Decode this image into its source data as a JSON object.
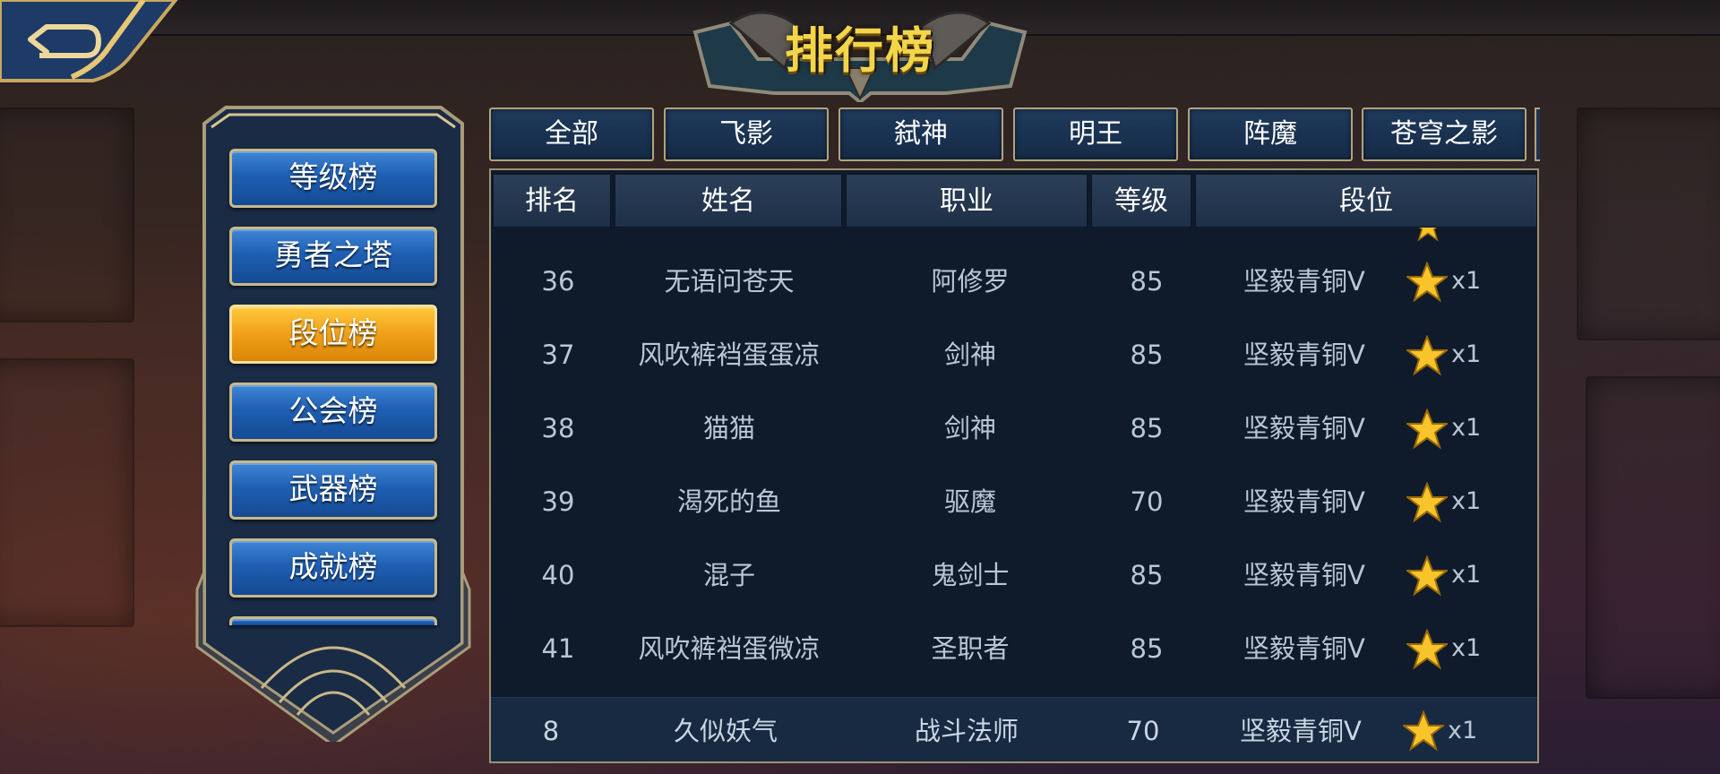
{
  "title": "排行榜",
  "nav": {
    "back_icon": "back-arrow-icon"
  },
  "sidebar": {
    "items": [
      {
        "label": "等级榜",
        "active": false
      },
      {
        "label": "勇者之塔",
        "active": false
      },
      {
        "label": "段位榜",
        "active": true
      },
      {
        "label": "公会榜",
        "active": false
      },
      {
        "label": "武器榜",
        "active": false
      },
      {
        "label": "成就榜",
        "active": false
      }
    ]
  },
  "tabs": [
    {
      "label": "全部"
    },
    {
      "label": "飞影"
    },
    {
      "label": "弑神"
    },
    {
      "label": "明王"
    },
    {
      "label": "阵魔"
    },
    {
      "label": "苍穹之影"
    }
  ],
  "table": {
    "headers": {
      "rank": "排名",
      "name": "姓名",
      "class": "职业",
      "level": "等级",
      "tier": "段位"
    },
    "rows": [
      {
        "rank": "36",
        "name": "无语问苍天",
        "class": "阿修罗",
        "level": "85",
        "tier": "坚毅青铜V",
        "stars": "x1"
      },
      {
        "rank": "37",
        "name": "风吹裤裆蛋蛋凉",
        "class": "剑神",
        "level": "85",
        "tier": "坚毅青铜V",
        "stars": "x1"
      },
      {
        "rank": "38",
        "name": "猫猫",
        "class": "剑神",
        "level": "85",
        "tier": "坚毅青铜V",
        "stars": "x1"
      },
      {
        "rank": "39",
        "name": "渴死的鱼",
        "class": "驱魔",
        "level": "70",
        "tier": "坚毅青铜V",
        "stars": "x1"
      },
      {
        "rank": "40",
        "name": "混子",
        "class": "鬼剑士",
        "level": "85",
        "tier": "坚毅青铜V",
        "stars": "x1"
      },
      {
        "rank": "41",
        "name": "风吹裤裆蛋微凉",
        "class": "圣职者",
        "level": "85",
        "tier": "坚毅青铜V",
        "stars": "x1"
      }
    ],
    "self_row": {
      "rank": "8",
      "name": "久似妖气",
      "class": "战斗法师",
      "level": "70",
      "tier": "坚毅青铜V",
      "stars": "x1"
    }
  },
  "colors": {
    "accent_gold": "#f3d54a",
    "active_button": "#f0a01a",
    "button_blue": "#1f5fb2",
    "table_bg": "#0f1b2b",
    "frame_gold": "#9d9173"
  }
}
